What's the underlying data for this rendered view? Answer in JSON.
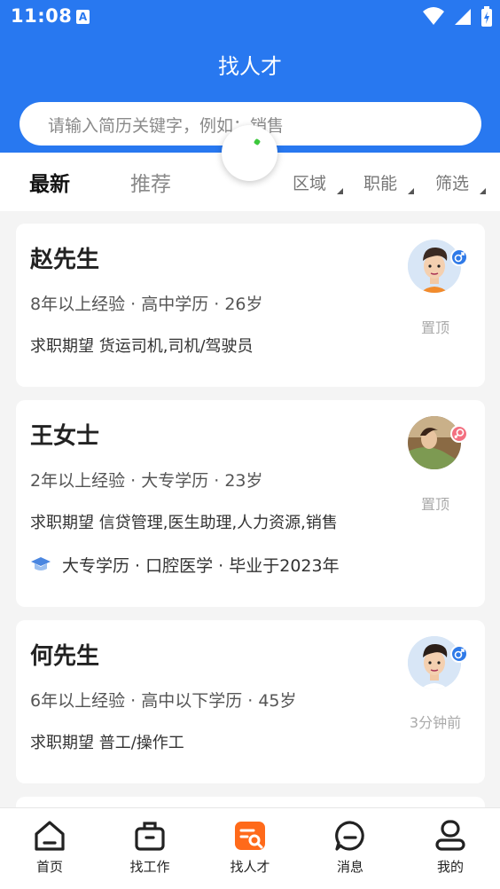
{
  "status": {
    "time": "11:08",
    "app_icon_letter": "A"
  },
  "header": {
    "title": "找人才"
  },
  "search": {
    "placeholder": "请输入简历关键字，例如：销售"
  },
  "tabs": {
    "active": "最新",
    "inactive": "推荐"
  },
  "filters": [
    "区域",
    "职能",
    "筛选"
  ],
  "candidates": [
    {
      "name": "赵先生",
      "meta": "8年以上经验 · 高中学历 · 26岁",
      "expect_label": "求职期望",
      "expect": "货运司机,司机/驾驶员",
      "side": "置顶",
      "gender": "male"
    },
    {
      "name": "王女士",
      "meta": "2年以上经验 · 大专学历 · 23岁",
      "expect_label": "求职期望",
      "expect": "信贷管理,医生助理,人力资源,销售",
      "education": "大专学历 · 口腔医学 · 毕业于2023年",
      "side": "置顶",
      "gender": "female"
    },
    {
      "name": "何先生",
      "meta": "6年以上经验 · 高中以下学历 · 45岁",
      "expect_label": "求职期望",
      "expect": "普工/操作工",
      "side": "3分钟前",
      "gender": "male"
    }
  ],
  "nav": [
    {
      "label": "首页",
      "icon": "home-icon"
    },
    {
      "label": "找工作",
      "icon": "briefcase-icon"
    },
    {
      "label": "找人才",
      "icon": "find-talent-icon",
      "active": true
    },
    {
      "label": "消息",
      "icon": "message-icon"
    },
    {
      "label": "我的",
      "icon": "profile-icon"
    }
  ],
  "colors": {
    "primary": "#2878f0",
    "accent": "#ff6a1a",
    "male": "#2f7ae8",
    "female": "#f37080"
  }
}
